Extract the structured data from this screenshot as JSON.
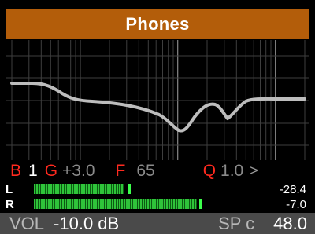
{
  "title": "Phones",
  "params": {
    "band_label": "B",
    "band_value": "1",
    "gain_label": "G",
    "gain_value": "+3.0",
    "freq_label": "F",
    "freq_value": "65",
    "q_label": "Q",
    "q_value": "1.0",
    "next_icon": "chevron-right-icon"
  },
  "meters": [
    {
      "channel": "L",
      "db": "-28.4",
      "level": 0.39,
      "peak": 0.41
    },
    {
      "channel": "R",
      "db": "-7.0",
      "level": 0.71,
      "peak": 0.72
    }
  ],
  "status": {
    "vol_label": "VOL",
    "vol_value": "-10.0 dB",
    "sp_label": "SP c",
    "sp_value": "48.0"
  },
  "colors": {
    "title_bar": "#b35d0a",
    "param_label": "#ff2a1f",
    "meter_green": "#2fc43a",
    "status_bar": "#4a4a4a",
    "curve": "#bdbdbd",
    "grid": "#5a5a5a"
  }
}
